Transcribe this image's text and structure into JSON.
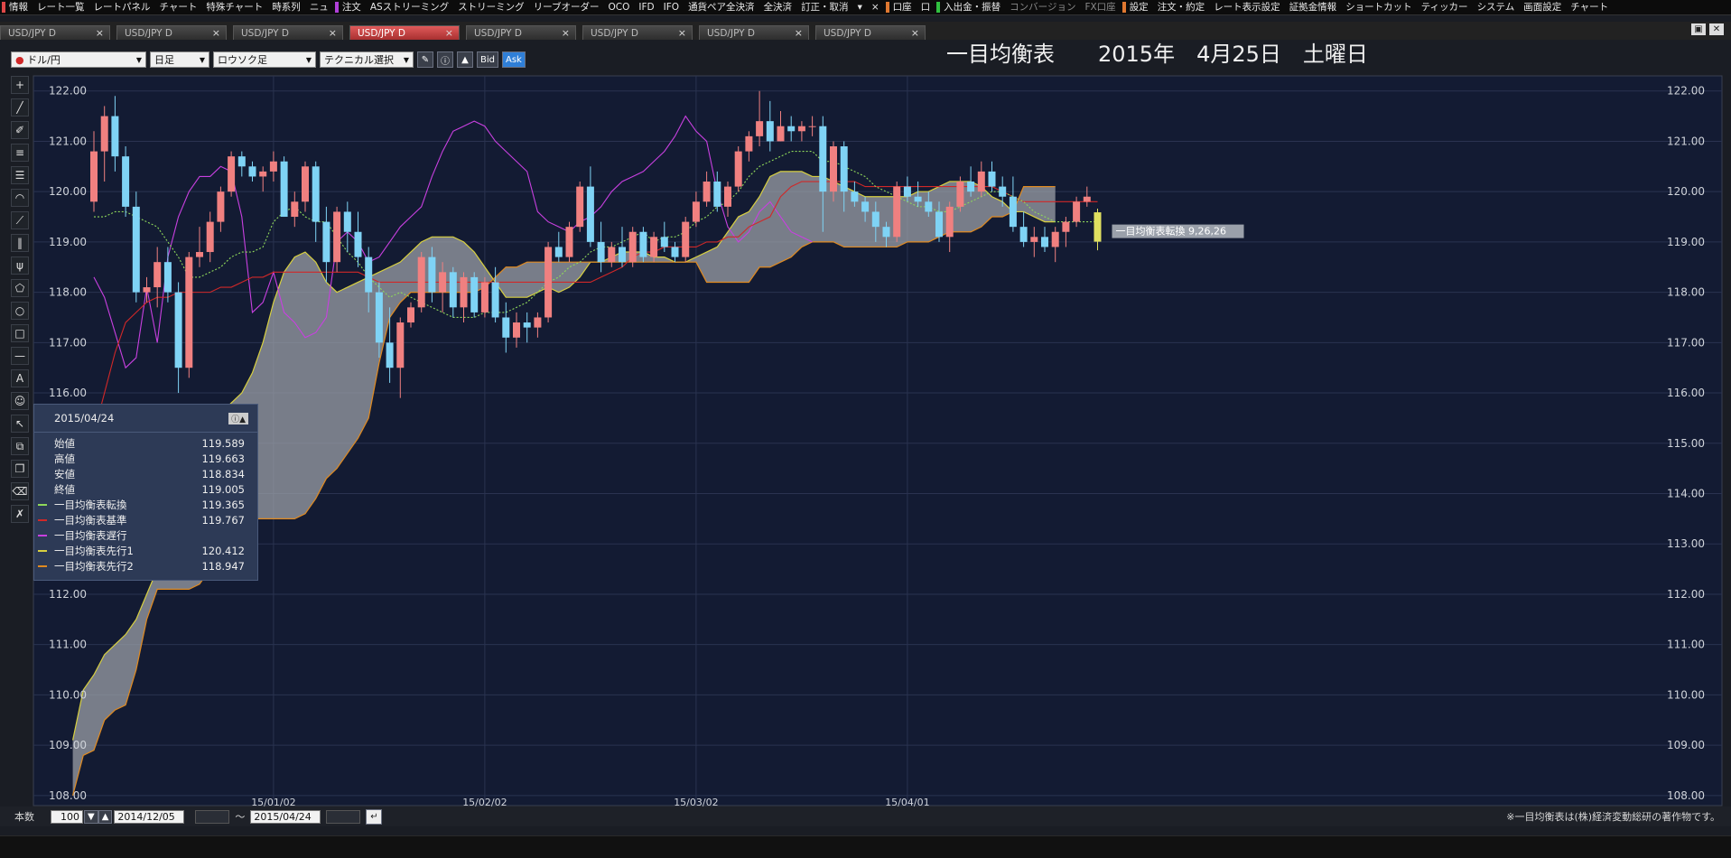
{
  "menubar": {
    "items": [
      {
        "label": "情報",
        "mark": "#e04848"
      },
      {
        "label": "レート一覧"
      },
      {
        "label": "レートパネル"
      },
      {
        "label": "チャート"
      },
      {
        "label": "特殊チャート"
      },
      {
        "label": "時系列"
      },
      {
        "label": "ニュ"
      },
      {
        "label": "注文",
        "mark": "#b040d8"
      },
      {
        "label": "ASストリーミング"
      },
      {
        "label": "ストリーミング"
      },
      {
        "label": "リーブオーダー"
      },
      {
        "label": "OCO"
      },
      {
        "label": "IFD"
      },
      {
        "label": "IFO"
      },
      {
        "label": "通貨ペア全決済"
      },
      {
        "label": "全決済"
      },
      {
        "label": "訂正・取消"
      },
      {
        "label": "▾"
      },
      {
        "label": "×"
      },
      {
        "label": "口座",
        "mark": "#e07830"
      },
      {
        "label": "口"
      },
      {
        "label": "入出金・振替",
        "mark": "#30c040"
      },
      {
        "label": "コンバージョン",
        "dim": true
      },
      {
        "label": "FX口座",
        "dim": true
      },
      {
        "label": "設定",
        "mark": "#e07830"
      },
      {
        "label": "注文・約定"
      },
      {
        "label": "レート表示設定"
      },
      {
        "label": "証拠金情報"
      },
      {
        "label": "ショートカット"
      },
      {
        "label": "ティッカー"
      },
      {
        "label": "システム"
      },
      {
        "label": "画面設定"
      },
      {
        "label": "チャート"
      }
    ]
  },
  "tabs": [
    {
      "label": "USD/JPY D",
      "active": false
    },
    {
      "label": "USD/JPY D",
      "active": false
    },
    {
      "label": "USD/JPY D",
      "active": false
    },
    {
      "label": "USD/JPY D",
      "active": true
    },
    {
      "label": "USD/JPY D",
      "active": false
    },
    {
      "label": "USD/JPY D",
      "active": false
    },
    {
      "label": "USD/JPY D",
      "active": false
    },
    {
      "label": "USD/JPY D",
      "active": false
    }
  ],
  "toolbar": {
    "currency": "ドル/円",
    "period": "日足",
    "chart_style": "ロウソク足",
    "technical": "テクニカル選択",
    "bid": "Bid",
    "ask": "Ask"
  },
  "title": "一目均衡表　　2015年　4月25日　土曜日",
  "infobox": {
    "date": "2015/04/24",
    "rows": [
      {
        "label": "始値",
        "value": "119.589",
        "color": ""
      },
      {
        "label": "高値",
        "value": "119.663",
        "color": ""
      },
      {
        "label": "安値",
        "value": "118.834",
        "color": ""
      },
      {
        "label": "終値",
        "value": "119.005",
        "color": ""
      },
      {
        "label": "一目均衡表転換",
        "value": "119.365",
        "color": "#8fd85a"
      },
      {
        "label": "一目均衡表基準",
        "value": "119.767",
        "color": "#d02828"
      },
      {
        "label": "一目均衡表遅行",
        "value": "",
        "color": "#c840e0"
      },
      {
        "label": "一目均衡表先行1",
        "value": "120.412",
        "color": "#d8d040"
      },
      {
        "label": "一目均衡表先行2",
        "value": "118.947",
        "color": "#e08a20"
      }
    ]
  },
  "bottombar": {
    "count_label": "本数",
    "count": "100",
    "date_from": "2014/12/05",
    "tilde": "〜",
    "date_to": "2015/04/24",
    "copyright": "※一目均衡表は(株)経済変動総研の著作物です。"
  },
  "chart_data": {
    "type": "candlestick",
    "ylim": [
      107.8,
      122.3
    ],
    "yticks": [
      "122.00",
      "121.00",
      "120.00",
      "119.00",
      "118.00",
      "117.00",
      "116.00",
      "115.00",
      "114.00",
      "113.00",
      "112.00",
      "111.00",
      "110.00",
      "109.00",
      "108.00"
    ],
    "xticks": [
      {
        "label": "15/01/02",
        "index": 17
      },
      {
        "label": "15/02/02",
        "index": 37
      },
      {
        "label": "15/03/02",
        "index": 57
      },
      {
        "label": "15/04/01",
        "index": 77
      }
    ],
    "tenkan_label": "一目均衡表転換 9,26,26",
    "candles": [
      [
        119.8,
        121.2,
        119.6,
        120.8
      ],
      [
        120.8,
        121.7,
        120.2,
        121.5
      ],
      [
        121.5,
        121.9,
        120.4,
        120.7
      ],
      [
        120.7,
        120.9,
        119.5,
        119.7
      ],
      [
        119.7,
        120.0,
        117.8,
        118.0
      ],
      [
        118.0,
        118.3,
        117.8,
        118.1
      ],
      [
        118.1,
        118.9,
        117.7,
        118.6
      ],
      [
        118.6,
        118.9,
        117.8,
        118.0
      ],
      [
        118.0,
        118.2,
        116.0,
        116.5
      ],
      [
        116.5,
        118.8,
        116.3,
        118.7
      ],
      [
        118.7,
        119.3,
        118.5,
        118.8
      ],
      [
        118.8,
        119.6,
        118.6,
        119.4
      ],
      [
        119.4,
        120.1,
        119.2,
        120.0
      ],
      [
        120.0,
        120.8,
        119.9,
        120.7
      ],
      [
        120.7,
        120.8,
        120.3,
        120.5
      ],
      [
        120.5,
        120.6,
        120.2,
        120.3
      ],
      [
        120.3,
        120.5,
        120.0,
        120.4
      ],
      [
        120.4,
        120.8,
        120.2,
        120.6
      ],
      [
        120.6,
        120.7,
        119.5,
        119.5
      ],
      [
        119.5,
        120.0,
        119.3,
        119.8
      ],
      [
        119.8,
        120.6,
        119.6,
        120.5
      ],
      [
        120.5,
        120.6,
        119.0,
        119.4
      ],
      [
        119.4,
        119.7,
        118.2,
        118.6
      ],
      [
        118.6,
        119.7,
        118.4,
        119.6
      ],
      [
        119.6,
        119.8,
        118.8,
        119.2
      ],
      [
        119.2,
        119.6,
        118.5,
        118.7
      ],
      [
        118.7,
        118.9,
        117.6,
        118.0
      ],
      [
        118.0,
        118.2,
        116.7,
        117.0
      ],
      [
        117.0,
        117.7,
        116.2,
        116.5
      ],
      [
        116.5,
        117.5,
        115.9,
        117.4
      ],
      [
        117.4,
        117.8,
        117.3,
        117.7
      ],
      [
        117.7,
        118.8,
        117.6,
        118.7
      ],
      [
        118.7,
        118.9,
        117.8,
        118.0
      ],
      [
        118.0,
        118.6,
        117.6,
        118.4
      ],
      [
        118.4,
        118.5,
        117.5,
        117.7
      ],
      [
        117.7,
        118.4,
        117.4,
        118.3
      ],
      [
        118.3,
        118.4,
        117.5,
        117.6
      ],
      [
        117.6,
        118.3,
        117.5,
        118.2
      ],
      [
        118.2,
        118.5,
        117.4,
        117.5
      ],
      [
        117.5,
        117.8,
        116.8,
        117.1
      ],
      [
        117.1,
        117.6,
        116.9,
        117.4
      ],
      [
        117.4,
        117.6,
        117.0,
        117.3
      ],
      [
        117.3,
        117.6,
        117.1,
        117.5
      ],
      [
        117.5,
        119.0,
        117.4,
        118.9
      ],
      [
        118.9,
        119.2,
        118.6,
        118.7
      ],
      [
        118.7,
        119.4,
        118.6,
        119.3
      ],
      [
        119.3,
        120.2,
        119.2,
        120.1
      ],
      [
        120.1,
        120.5,
        118.9,
        119.0
      ],
      [
        119.0,
        119.4,
        118.4,
        118.6
      ],
      [
        118.6,
        119.0,
        118.5,
        118.9
      ],
      [
        118.9,
        119.3,
        118.5,
        118.6
      ],
      [
        118.6,
        119.3,
        118.5,
        119.2
      ],
      [
        119.2,
        119.3,
        118.6,
        118.7
      ],
      [
        118.7,
        119.2,
        118.6,
        119.1
      ],
      [
        119.1,
        119.4,
        118.8,
        118.9
      ],
      [
        118.9,
        119.0,
        118.6,
        118.7
      ],
      [
        118.7,
        119.5,
        118.6,
        119.4
      ],
      [
        119.4,
        120.0,
        119.3,
        119.8
      ],
      [
        119.8,
        120.4,
        119.7,
        120.2
      ],
      [
        120.2,
        120.4,
        119.6,
        119.7
      ],
      [
        119.7,
        120.2,
        119.5,
        120.1
      ],
      [
        120.1,
        120.9,
        120.0,
        120.8
      ],
      [
        120.8,
        121.2,
        120.6,
        121.1
      ],
      [
        121.1,
        122.0,
        120.9,
        121.4
      ],
      [
        121.4,
        121.8,
        120.8,
        121.0
      ],
      [
        121.0,
        121.6,
        121.0,
        121.3
      ],
      [
        121.3,
        121.5,
        121.0,
        121.2
      ],
      [
        121.2,
        121.4,
        121.0,
        121.3
      ],
      [
        121.3,
        121.5,
        121.1,
        121.3
      ],
      [
        121.3,
        121.5,
        119.2,
        120.0
      ],
      [
        120.0,
        121.0,
        119.8,
        120.9
      ],
      [
        120.9,
        121.0,
        119.6,
        120.0
      ],
      [
        120.0,
        120.2,
        119.7,
        119.8
      ],
      [
        119.8,
        119.9,
        119.4,
        119.6
      ],
      [
        119.6,
        119.8,
        119.0,
        119.3
      ],
      [
        119.3,
        119.4,
        118.9,
        119.1
      ],
      [
        119.1,
        120.2,
        119.0,
        120.1
      ],
      [
        120.1,
        120.3,
        119.8,
        119.9
      ],
      [
        119.9,
        120.2,
        119.7,
        119.8
      ],
      [
        119.8,
        120.0,
        119.5,
        119.6
      ],
      [
        119.6,
        119.8,
        119.0,
        119.1
      ],
      [
        119.1,
        119.8,
        118.8,
        119.7
      ],
      [
        119.7,
        120.3,
        119.6,
        120.2
      ],
      [
        120.2,
        120.5,
        119.9,
        120.0
      ],
      [
        120.0,
        120.6,
        119.9,
        120.4
      ],
      [
        120.4,
        120.6,
        120.0,
        120.1
      ],
      [
        120.1,
        120.3,
        119.7,
        119.9
      ],
      [
        119.9,
        120.3,
        119.2,
        119.3
      ],
      [
        119.3,
        119.6,
        118.9,
        119.0
      ],
      [
        119.0,
        119.3,
        118.7,
        119.1
      ],
      [
        119.1,
        119.3,
        118.8,
        118.9
      ],
      [
        118.9,
        119.3,
        118.6,
        119.2
      ],
      [
        119.2,
        119.5,
        118.9,
        119.4
      ],
      [
        119.4,
        119.9,
        119.3,
        119.8
      ],
      [
        119.8,
        120.1,
        119.7,
        119.9
      ],
      [
        119.589,
        119.663,
        118.834,
        119.005
      ]
    ],
    "tenkan": [
      119.5,
      119.5,
      119.6,
      119.6,
      119.5,
      119.4,
      119.3,
      119.0,
      118.7,
      118.3,
      118.3,
      118.4,
      118.5,
      118.7,
      118.8,
      118.8,
      118.9,
      119.4,
      119.6,
      119.7,
      119.5,
      119.4,
      119.4,
      119.1,
      118.8,
      118.6,
      118.3,
      118.1,
      117.9,
      118.0,
      117.9,
      117.8,
      117.7,
      117.6,
      117.5,
      117.5,
      117.5,
      117.6,
      117.6,
      117.6,
      117.7,
      117.8,
      118.0,
      118.2,
      118.3,
      118.5,
      118.6,
      118.8,
      118.9,
      118.9,
      119.0,
      119.1,
      119.2,
      119.0,
      119.1,
      119.1,
      119.2,
      119.4,
      119.5,
      119.7,
      119.8,
      120.0,
      120.3,
      120.5,
      120.6,
      120.7,
      120.8,
      120.8,
      120.8,
      120.6,
      120.6,
      120.5,
      120.4,
      120.3,
      120.1,
      120.0,
      119.9,
      119.8,
      119.7,
      119.7,
      119.6,
      119.6,
      119.7,
      119.8,
      119.9,
      120.0,
      120.0,
      119.9,
      119.8,
      119.6,
      119.5,
      119.4,
      119.4,
      119.4,
      119.4,
      119.4
    ],
    "kijun": [
      115.2,
      116.0,
      116.8,
      117.4,
      117.6,
      117.8,
      117.9,
      117.9,
      118.0,
      118.0,
      118.0,
      118.0,
      118.1,
      118.1,
      118.2,
      118.3,
      118.3,
      118.4,
      118.4,
      118.4,
      118.4,
      118.4,
      118.4,
      118.4,
      118.4,
      118.4,
      118.3,
      118.2,
      118.2,
      118.2,
      118.2,
      118.2,
      118.2,
      118.2,
      118.2,
      118.2,
      118.2,
      118.2,
      118.2,
      118.2,
      118.2,
      118.2,
      118.2,
      118.2,
      118.2,
      118.2,
      118.2,
      118.2,
      118.3,
      118.4,
      118.5,
      118.7,
      118.8,
      118.8,
      118.9,
      118.9,
      118.9,
      118.9,
      119.0,
      119.0,
      119.1,
      119.1,
      119.3,
      119.4,
      119.5,
      119.9,
      120.1,
      120.2,
      120.2,
      120.2,
      120.2,
      120.2,
      120.2,
      120.1,
      120.1,
      120.1,
      120.1,
      120.1,
      120.1,
      120.1,
      120.1,
      120.1,
      120.1,
      120.1,
      120.1,
      120.1,
      120.0,
      119.9,
      119.8,
      119.8,
      119.8,
      119.8,
      119.8,
      119.8,
      119.8,
      119.8
    ],
    "chikou": [
      118.3,
      117.9,
      117.2,
      116.5,
      116.7,
      118.1,
      117.0,
      118.7,
      119.5,
      120.0,
      120.3,
      120.3,
      120.5,
      120.4,
      119.5,
      117.6,
      117.8,
      118.4,
      117.6,
      117.4,
      117.1,
      117.2,
      117.5,
      119.0,
      119.2,
      119.0,
      118.6,
      118.7,
      119.0,
      119.3,
      119.5,
      119.7,
      120.3,
      120.8,
      121.2,
      121.3,
      121.4,
      121.3,
      121.0,
      120.8,
      120.6,
      120.4,
      119.6,
      119.4,
      119.3,
      119.2,
      119.4,
      119.5,
      119.7,
      120.0,
      120.2,
      120.3,
      120.4,
      120.6,
      120.8,
      121.1,
      121.5,
      121.2,
      121.0,
      120.0,
      119.3,
      119.0,
      119.2,
      119.6,
      119.8,
      119.5,
      119.2,
      119.1,
      119.0
    ],
    "senkou1": [
      109.1,
      110.1,
      110.4,
      110.8,
      111.0,
      111.2,
      111.5,
      112.0,
      112.5,
      113.1,
      114.0,
      114.6,
      115.0,
      115.3,
      115.6,
      115.8,
      116.0,
      116.4,
      117.0,
      117.8,
      118.4,
      118.7,
      118.8,
      118.6,
      118.2,
      118.0,
      118.1,
      118.2,
      118.3,
      118.4,
      118.5,
      118.6,
      118.8,
      119.0,
      119.1,
      119.1,
      119.1,
      119.0,
      118.8,
      118.5,
      118.2,
      117.9,
      117.9,
      117.9,
      118.0,
      118.1,
      118.0,
      118.1,
      118.3,
      118.6,
      118.6,
      118.7,
      118.8,
      118.8,
      118.8,
      118.7,
      118.7,
      118.6,
      118.6,
      118.7,
      118.8,
      118.9,
      119.2,
      119.5,
      119.6,
      119.9,
      120.3,
      120.4,
      120.4,
      120.4,
      120.3,
      120.3,
      120.2,
      120.1,
      120.0,
      119.9,
      119.9,
      119.9,
      119.9,
      119.9,
      120.0,
      120.0,
      120.1,
      120.2,
      120.2,
      120.2,
      120.1,
      119.9,
      119.8,
      119.6,
      119.6,
      119.5,
      119.4,
      119.4
    ],
    "senkou2": [
      108.0,
      108.8,
      108.9,
      109.5,
      109.7,
      109.8,
      110.5,
      111.5,
      112.1,
      112.1,
      112.1,
      112.1,
      112.2,
      112.5,
      112.9,
      113.2,
      113.3,
      113.5,
      113.5,
      113.5,
      113.5,
      113.5,
      113.6,
      113.9,
      114.3,
      114.5,
      114.8,
      115.1,
      115.5,
      116.6,
      117.5,
      117.8,
      118.0,
      118.0,
      118.0,
      118.0,
      118.0,
      118.0,
      118.0,
      118.1,
      118.3,
      118.5,
      118.5,
      118.6,
      118.6,
      118.6,
      118.6,
      118.6,
      118.6,
      118.6,
      118.6,
      118.6,
      118.6,
      118.6,
      118.6,
      118.6,
      118.6,
      118.6,
      118.6,
      118.6,
      118.2,
      118.2,
      118.2,
      118.2,
      118.2,
      118.5,
      118.5,
      118.6,
      118.7,
      118.9,
      119.0,
      119.0,
      119.0,
      118.9,
      118.9,
      118.9,
      118.9,
      118.9,
      118.9,
      119.0,
      119.0,
      119.0,
      119.1,
      119.2,
      119.2,
      119.2,
      119.3,
      119.5,
      119.5,
      119.6,
      120.1,
      120.1,
      120.1,
      120.1
    ]
  }
}
